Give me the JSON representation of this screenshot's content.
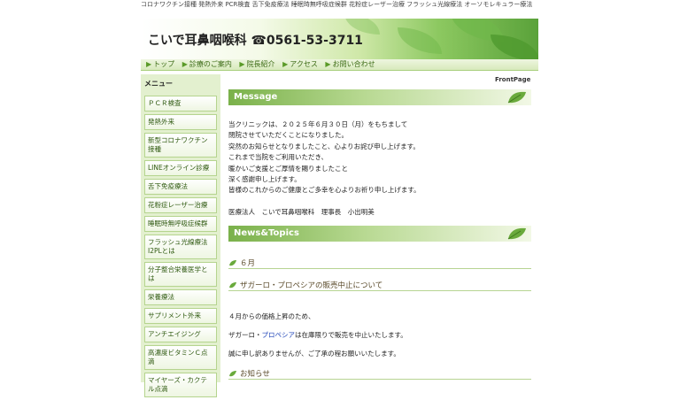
{
  "keywords": "コロナワクチン接種 発熱外来 PCR検査 舌下免疫療法 睡眠時無呼吸症候群 花粉症レーザー治療 フラッシュ光線療法 オーソモレキュラー療法",
  "header": {
    "clinic_name": "こいで耳鼻咽喉科 ☎0561-53-3711"
  },
  "nav": [
    {
      "label": "トップ"
    },
    {
      "label": "診療のご案内"
    },
    {
      "label": "院長紹介"
    },
    {
      "label": "アクセス"
    },
    {
      "label": "お問い合わせ"
    }
  ],
  "sidebar": {
    "title": "メニュー",
    "items": [
      {
        "label": "ＰＣＲ検査"
      },
      {
        "label": "発熱外来"
      },
      {
        "label": "新型コロナワクチン接種"
      },
      {
        "label": "LINEオンライン診療"
      },
      {
        "label": "舌下免疫療法"
      },
      {
        "label": "花粉症レーザー治療"
      },
      {
        "label": "睡眠時無呼吸症候群"
      },
      {
        "label": "フラッシュ光線療法I2PLとは"
      },
      {
        "label": "分子整合栄養医学とは"
      },
      {
        "label": "栄養療法"
      },
      {
        "label": "サプリメント外来"
      },
      {
        "label": "アンチエイジング"
      },
      {
        "label": "高濃度ビタミンＣ点滴"
      },
      {
        "label": "マイヤーズ・カクテル点滴"
      }
    ]
  },
  "main": {
    "frontpage": "FrontPage",
    "message_title": "Message",
    "message_lines": [
      "当クリニックは、２０２５年６月３０日（月）をもちまして",
      "閉院させていただくことになりました。",
      "突然のお知らせとなりましたこと、心よりお詫び申し上げます。",
      "これまで当院をご利用いただき、",
      "暖かいご支援とご厚情を賜りましたこと",
      "深く感謝申し上げます。",
      "皆様のこれからのご健康とご多幸を心よりお祈り申し上げます。"
    ],
    "signature": "医療法人　こいで耳鼻咽喉科　理事長　小出明美",
    "news_title": "News&Topics",
    "month_heading": "６月",
    "topic_heading": "ザガーロ・プロペシアの販売中止について",
    "topic_line1": "４月からの価格上昇のため、",
    "topic_line2_pre": "ザガーロ・",
    "topic_line2_link": "プロペシア",
    "topic_line2_post": "は在庫限りで販売を中止いたします。",
    "topic_line3": "誠に申し訳ありませんが、ご了承の程お願いいたします。",
    "notice_heading": "お知らせ"
  }
}
